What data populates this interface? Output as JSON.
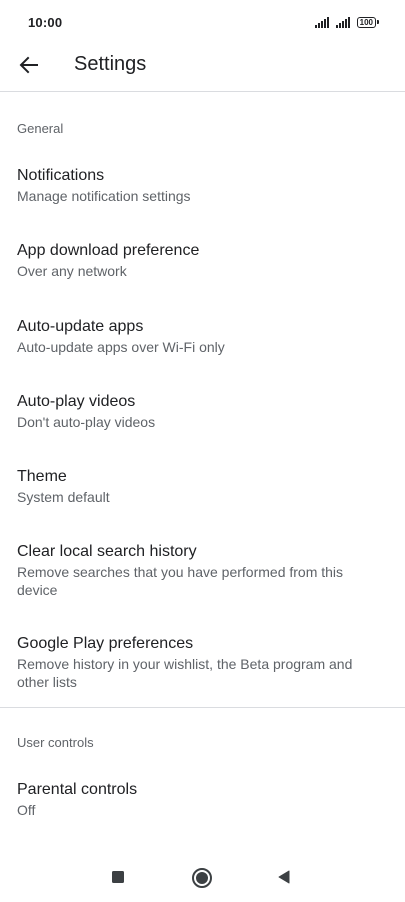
{
  "status_bar": {
    "time": "10:00",
    "battery": "100"
  },
  "app_bar": {
    "title": "Settings"
  },
  "sections": {
    "general": {
      "header": "General",
      "items": [
        {
          "title": "Notifications",
          "subtitle": "Manage notification settings"
        },
        {
          "title": "App download preference",
          "subtitle": "Over any network"
        },
        {
          "title": "Auto-update apps",
          "subtitle": "Auto-update apps over Wi-Fi only"
        },
        {
          "title": "Auto-play videos",
          "subtitle": "Don't auto-play videos"
        },
        {
          "title": "Theme",
          "subtitle": "System default"
        },
        {
          "title": "Clear local search history",
          "subtitle": "Remove searches that you have performed from this device"
        },
        {
          "title": "Google Play preferences",
          "subtitle": "Remove history in your wishlist, the Beta program and other lists"
        }
      ]
    },
    "user_controls": {
      "header": "User controls",
      "items": [
        {
          "title": "Parental controls",
          "subtitle": "Off"
        }
      ]
    }
  },
  "icons": {
    "back": "arrow-back-icon",
    "recents": "square-icon",
    "home": "circle-icon",
    "back_nav": "triangle-back-icon"
  }
}
